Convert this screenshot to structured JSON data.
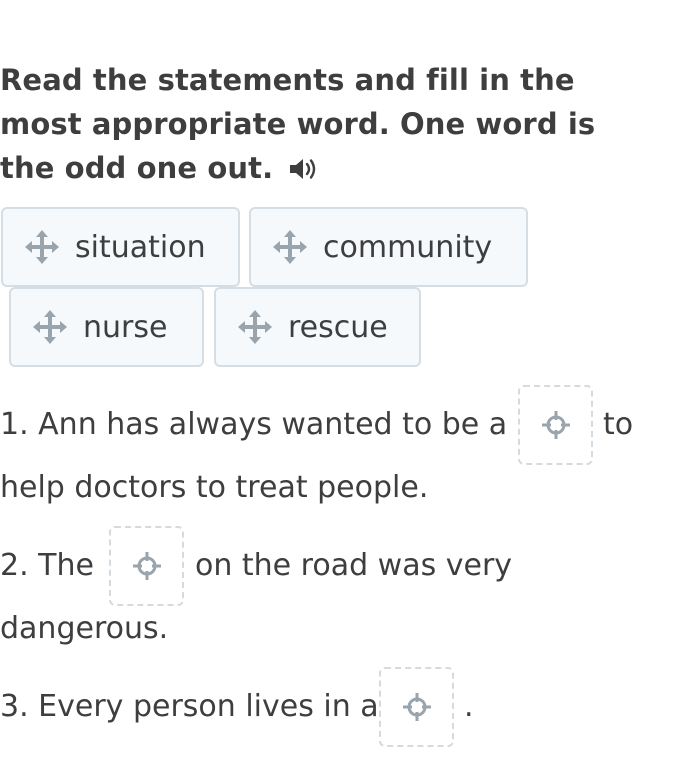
{
  "instructions": {
    "text": "Read the statements and fill in the most appropriate word. One word is the odd one out."
  },
  "word_bank": [
    {
      "label": "situation"
    },
    {
      "label": "community"
    },
    {
      "label": "nurse"
    },
    {
      "label": "rescue"
    }
  ],
  "sentences": [
    {
      "before": "1. Ann has always wanted to be a",
      "after": "to",
      "continuation": "help doctors to treat people."
    },
    {
      "before": "2. The",
      "after": "on the road was very",
      "continuation": "dangerous."
    },
    {
      "before": "3. Every person lives in a",
      "after": "."
    }
  ],
  "icons": {
    "audio": "speaker-icon",
    "drag": "move-arrows-icon",
    "drop": "crosshair-target-icon"
  },
  "colors": {
    "chip_background": "#f5f9fc",
    "chip_border": "#d5dee5",
    "icon_gray": "#9aa4ad",
    "text": "#3e3e3e"
  }
}
